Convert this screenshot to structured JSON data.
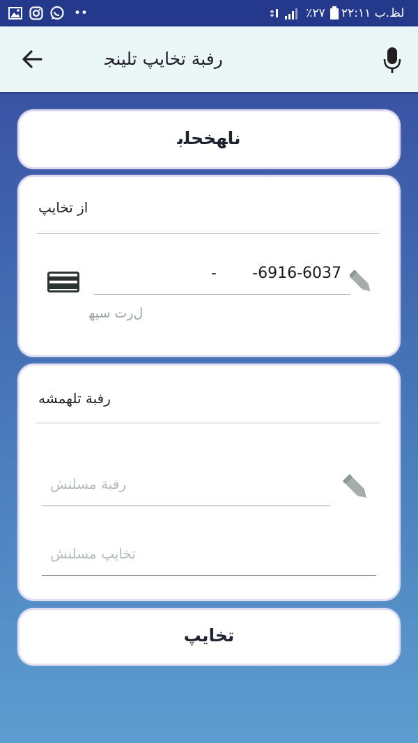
{
  "status_bar": {
    "time": "ﻟﻆ.ﺏ ٢٢:١١",
    "battery_percent": "٢٧٪",
    "overflow": "••",
    "icons_left": [
      "gallery-icon",
      "instagram-icon",
      "whatsapp-icon"
    ],
    "icons_right": [
      "data-icon",
      "signal-icon",
      "battery-icon"
    ]
  },
  "app_bar": {
    "title": "ﺭﻓﺒﺔ ﺗﺨﺎﻳﭗ ﺗﻠﻴﻨﺠ",
    "back_icon": "arrow-left-icon",
    "mic_icon": "microphone-icon"
  },
  "top_button": {
    "label": "ﻧﺎﻬﺨﺤﻠﺑ"
  },
  "source_card": {
    "heading": "ﺍﺯ ﺗﺨﺎﻳﭗ",
    "card_number": "-6916-6037",
    "separator": "-",
    "helper": "ﻝﺭﺕ ﺳﻴﻬ",
    "icon": "credit-card-icon",
    "edit_icon": "pencil-icon"
  },
  "destination_card": {
    "heading": "ﺭﻓﺒﺔ ﺗﻠﻬﻤﺸﻪ",
    "field1_placeholder": "ﺭﻓﺒﺔ ﻣﺴﻠﻨﺶ",
    "field2_placeholder": "ﺗﺨﺎﻳﭗ ﻣﺴﻠﻨﺶ",
    "edit_icon": "pencil-icon"
  },
  "pay_button": {
    "label": "ﺗﺨﺎﻳﭗ"
  },
  "colors": {
    "status_bar": "#24398b",
    "app_bar": "#ebf7f6",
    "background_top": "#3a53a4",
    "background_bottom": "#5d9dd0",
    "card": "#ffffff",
    "placeholder": "#b3bcbc",
    "icon_gray": "#a4adac"
  }
}
